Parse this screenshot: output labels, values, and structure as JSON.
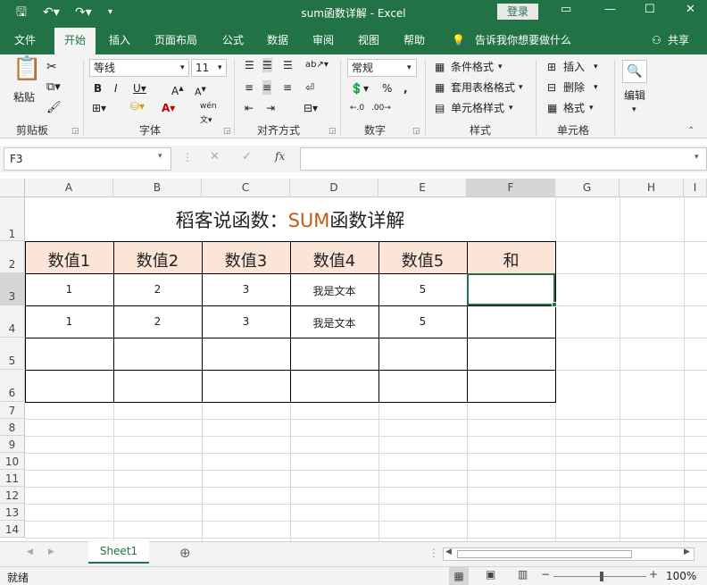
{
  "window": {
    "title": "sum函数详解 - Excel",
    "login_label": "登录"
  },
  "tabs": [
    "文件",
    "开始",
    "插入",
    "页面布局",
    "公式",
    "数据",
    "审阅",
    "视图",
    "帮助"
  ],
  "tell_me": "告诉我你想要做什么",
  "share": "共享",
  "ribbon": {
    "clipboard": {
      "paste": "粘贴",
      "label": "剪贴板"
    },
    "font": {
      "name": "等线",
      "size": "11",
      "label": "字体"
    },
    "alignment": {
      "label": "对齐方式"
    },
    "number": {
      "format": "常规",
      "label": "数字"
    },
    "styles": {
      "conditional": "条件格式",
      "table": "套用表格格式",
      "cell": "单元格样式",
      "label": "样式"
    },
    "cells": {
      "insert": "插入",
      "delete": "删除",
      "format": "格式",
      "label": "单元格"
    },
    "editing": {
      "label": "编辑"
    }
  },
  "namebox": "F3",
  "columns": [
    "A",
    "B",
    "C",
    "D",
    "E",
    "F",
    "G",
    "H",
    "I"
  ],
  "rows": [
    "1",
    "2",
    "3",
    "4",
    "5",
    "6",
    "7",
    "8",
    "9",
    "10",
    "11",
    "12",
    "13",
    "14"
  ],
  "sheet": {
    "title_prefix": "稻客说函数：",
    "title_highlight": "SUM",
    "title_suffix": "函数详解",
    "headers": [
      "数值1",
      "数值2",
      "数值3",
      "数值4",
      "数值5",
      "和"
    ],
    "data": [
      [
        "1",
        "2",
        "3",
        "我是文本",
        "5",
        ""
      ],
      [
        "1",
        "2",
        "3",
        "我是文本",
        "5",
        ""
      ],
      [
        "",
        "",
        "",
        "",
        "",
        ""
      ],
      [
        "",
        "",
        "",
        "",
        "",
        ""
      ]
    ]
  },
  "sheet_tab": "Sheet1",
  "status": {
    "ready": "就绪",
    "zoom": "100%"
  },
  "colors": {
    "excel_green": "#217346",
    "header_fill": "#fce4d6",
    "title_accent": "#c65911"
  }
}
